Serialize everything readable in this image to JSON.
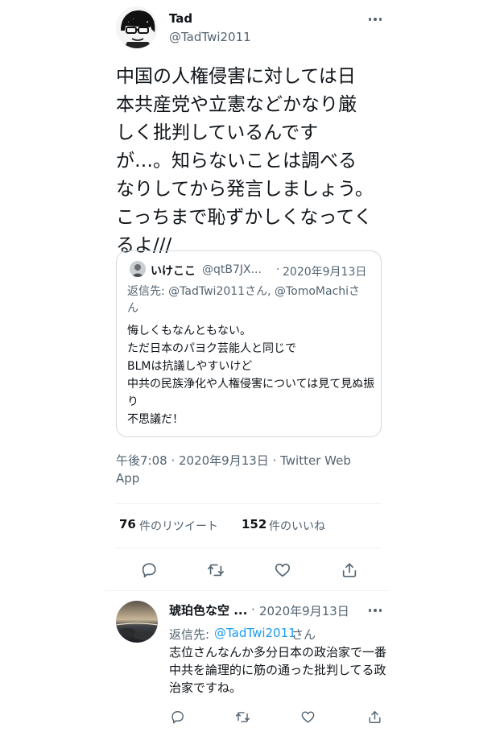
{
  "main_tweet": {
    "author_name": "Tad",
    "author_handle": "@TadTwi2011",
    "text": "中国の人権侵害に対しては日本共産党や立憲などかなり厳しく批判しているんですが…。知らないことは調べるなりしてから発言しましょう。こっちまで恥ずかしくなってくるよ///",
    "timestamp": "午後7:08 · 2020年9月13日 · Twitter Web App",
    "retweet_count": "76",
    "retweet_label": "件のリツイート",
    "like_count": "152",
    "like_label": "件のいいね",
    "icons": [
      "avatar",
      "more-icon",
      "reply-icon",
      "retweet-icon",
      "like-icon",
      "share-icon"
    ]
  },
  "quoted_tweet": {
    "author_name": "いけここ",
    "author_handle": "@qtB7JX...",
    "separator": "·",
    "date": "2020年9月13日",
    "reply_to": "返信先: @TadTwi2011さん, @TomoMachiさん",
    "text": "悔しくもなんともない。\nただ日本のパヨク芸能人と同じで\nBLMは抗議しやすいけど\n中共の民族浄化や人権侵害については見て見ぬ振り\n不思議だ！"
  },
  "reply_tweet": {
    "author_name": "琥珀色な空 ...",
    "separator": "·",
    "date": "2020年9月13日",
    "reply_to_label": "返信先:",
    "reply_to_handle": "@TadTwi2011",
    "reply_to_suffix": "さん",
    "text": "志位さんなんか多分日本の政治家で一番中共を論理的に筋の通った批判してる政治家ですね。"
  },
  "colors": {
    "text": "#0f1419",
    "secondary": "#536471",
    "link": "#1d9bf0",
    "border": "#cfd9de"
  }
}
